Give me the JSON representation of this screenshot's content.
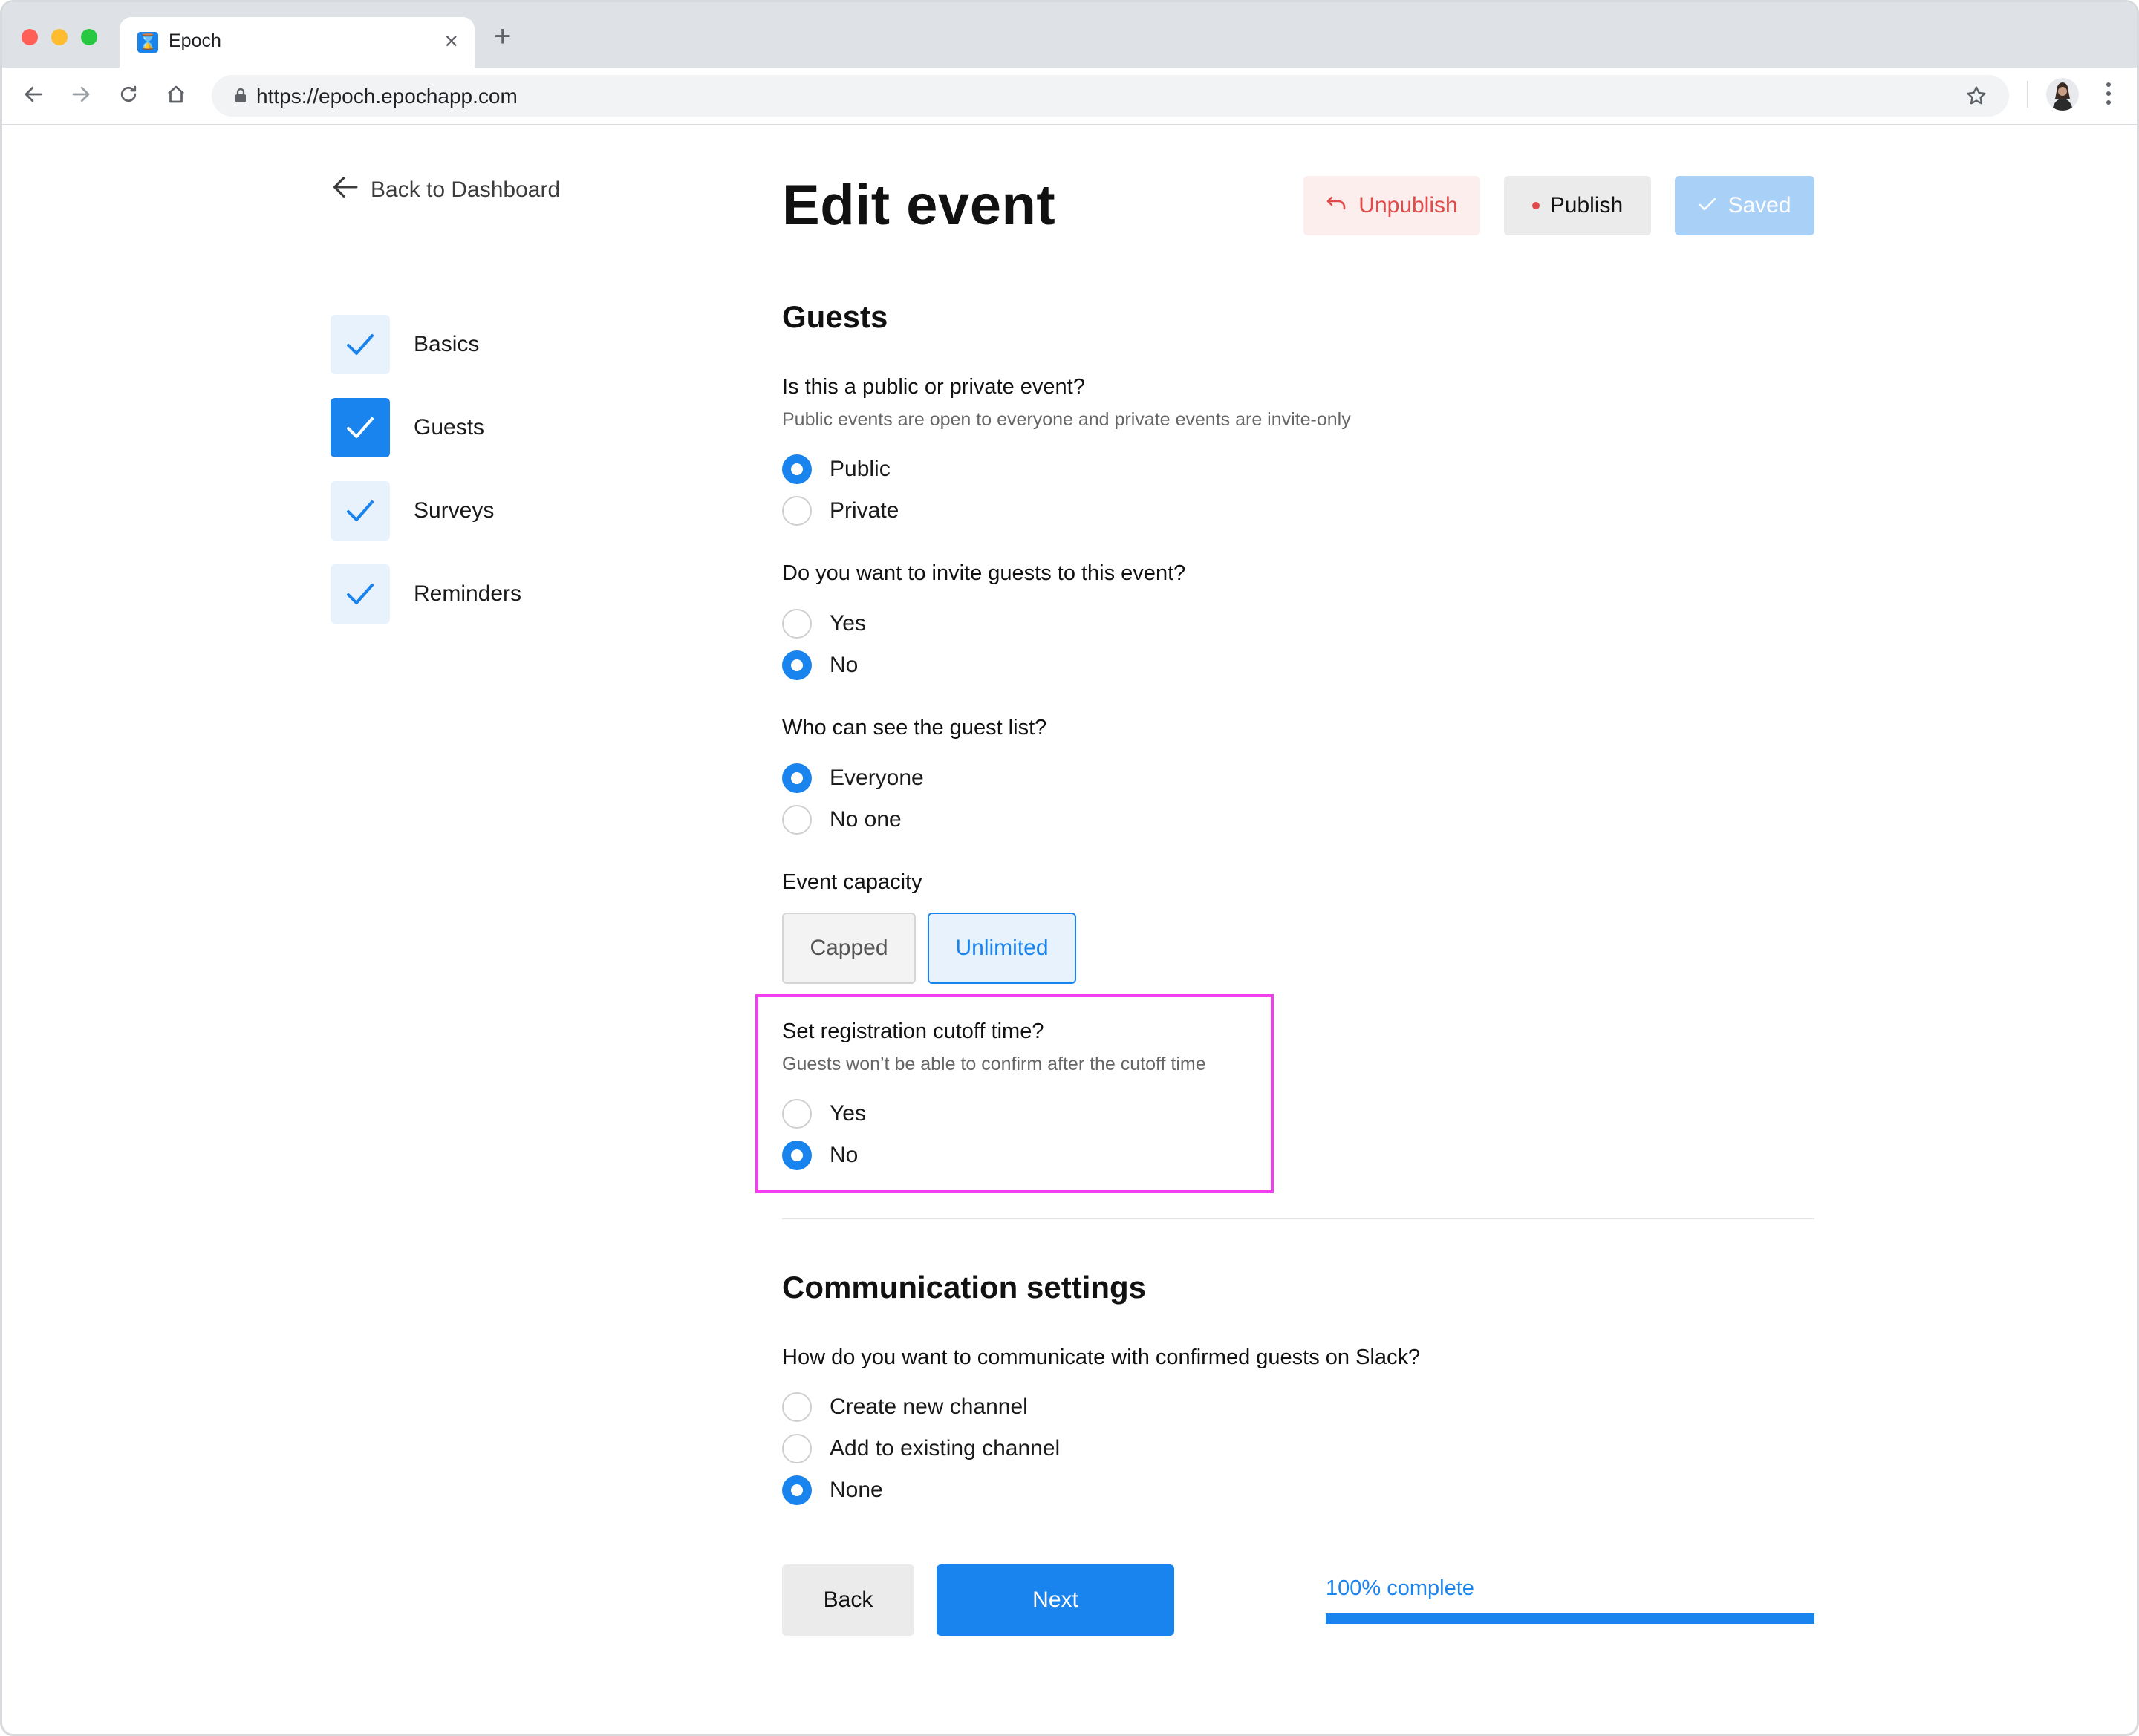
{
  "browser": {
    "tab_title": "Epoch",
    "favicon_glyph": "⌛",
    "url": "https://epoch.epochapp.com"
  },
  "nav": {
    "back_to_dashboard": "Back to Dashboard",
    "steps": [
      {
        "label": "Basics",
        "complete": true,
        "active": false
      },
      {
        "label": "Guests",
        "complete": true,
        "active": true
      },
      {
        "label": "Surveys",
        "complete": true,
        "active": false
      },
      {
        "label": "Reminders",
        "complete": true,
        "active": false
      }
    ]
  },
  "header": {
    "title": "Edit event",
    "unpublish_label": "Unpublish",
    "publish_label": "Publish",
    "saved_label": "Saved"
  },
  "guests": {
    "section_title": "Guests",
    "visibility": {
      "question": "Is this a public or private event?",
      "help": "Public events are open to everyone and private events are invite-only",
      "options": [
        "Public",
        "Private"
      ],
      "selected": "Public"
    },
    "invite": {
      "question": "Do you want to invite guests to this event?",
      "options": [
        "Yes",
        "No"
      ],
      "selected": "No"
    },
    "guest_list": {
      "question": "Who can see the guest list?",
      "options": [
        "Everyone",
        "No one"
      ],
      "selected": "Everyone"
    },
    "capacity": {
      "label": "Event capacity",
      "options": [
        "Capped",
        "Unlimited"
      ],
      "selected": "Unlimited"
    },
    "cutoff": {
      "question": "Set registration cutoff time?",
      "help": "Guests won’t be able to confirm after the cutoff time",
      "options": [
        "Yes",
        "No"
      ],
      "selected": "No"
    }
  },
  "communication": {
    "section_title": "Communication settings",
    "question": "How do you want to communicate with confirmed guests on Slack?",
    "options": [
      "Create new channel",
      "Add to existing channel",
      "None"
    ],
    "selected": "None"
  },
  "footer": {
    "back_label": "Back",
    "next_label": "Next",
    "progress_label": "100% complete",
    "progress_value": 1.0
  },
  "colors": {
    "accent": "#1a84ee",
    "danger": "#e04a4a",
    "highlight": "#f13ff0"
  }
}
